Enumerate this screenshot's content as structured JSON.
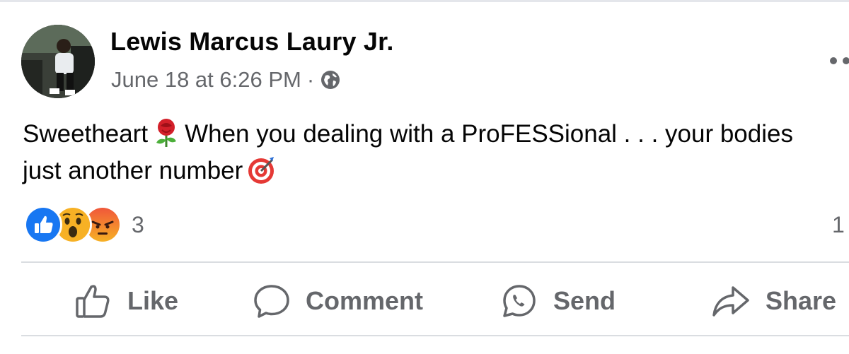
{
  "post": {
    "author": "Lewis Marcus Laury Jr.",
    "date": "June 18 at 6:26 PM",
    "separator": "·",
    "privacy_icon": "globe-icon",
    "text_part1": "Sweetheart",
    "emoji1": "rose-emoji",
    "text_part2": "When you dealing with a ProFESSional . . . your bodies just another number",
    "emoji2": "direct-hit-target-emoji"
  },
  "reactions": {
    "types": [
      "like",
      "wow",
      "angry"
    ],
    "count": "3",
    "comments_count": "1"
  },
  "actions": {
    "like": "Like",
    "comment": "Comment",
    "send": "Send",
    "share": "Share"
  },
  "colors": {
    "text": "#050505",
    "secondary": "#65676b",
    "like_blue": "#1877f2",
    "divider": "#dadde1"
  }
}
